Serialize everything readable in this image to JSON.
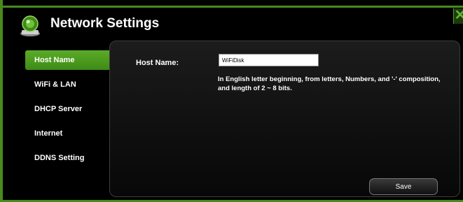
{
  "header": {
    "title": "Network Settings",
    "icon": "network-monitor-icon",
    "close_icon": "close-x-icon"
  },
  "sidebar": {
    "items": [
      {
        "label": "Host Name",
        "active": true
      },
      {
        "label": "WiFi & LAN",
        "active": false
      },
      {
        "label": "DHCP Server",
        "active": false
      },
      {
        "label": "Internet",
        "active": false
      },
      {
        "label": "DDNS Setting",
        "active": false
      }
    ]
  },
  "form": {
    "host_name_label": "Host Name:",
    "host_name_value": "WiFiDisk",
    "hint": "In English letter beginning, from letters, Numbers, and '-' composition, and length of 2 ~ 8 bits.",
    "save_label": "Save"
  },
  "colors": {
    "accent": "#4a8a1c",
    "active_item": "#52a022",
    "panel_border": "#3d3d3d"
  }
}
